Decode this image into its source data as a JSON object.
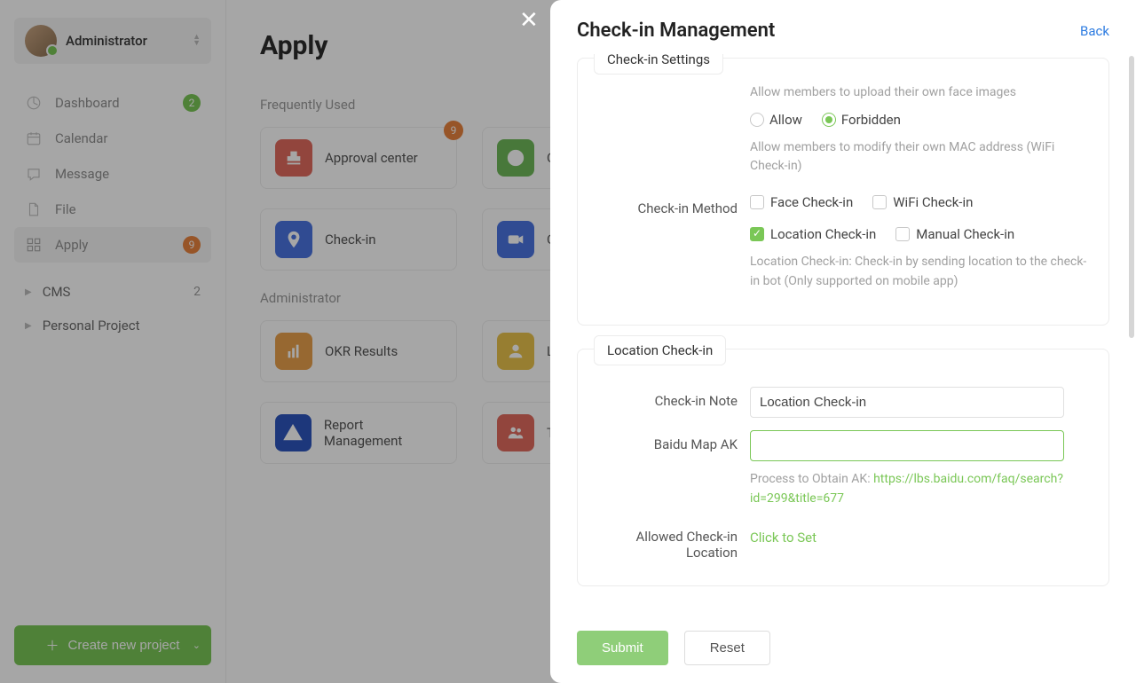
{
  "sidebar": {
    "user": "Administrator",
    "nav": [
      {
        "label": "Dashboard",
        "badge": "2",
        "badgeColor": "green"
      },
      {
        "label": "Calendar"
      },
      {
        "label": "Message"
      },
      {
        "label": "File"
      },
      {
        "label": "Apply",
        "badge": "9",
        "badgeColor": "orange",
        "active": true
      }
    ],
    "sections": [
      {
        "label": "CMS",
        "count": "2"
      },
      {
        "label": "Personal Project"
      }
    ],
    "newProject": "Create new project"
  },
  "main": {
    "title": "Apply",
    "freqHeading": "Frequently Used",
    "adminHeading": "Administrator",
    "tiles": {
      "approval": {
        "label": "Approval center",
        "badge": "9",
        "color": "#e06a5e"
      },
      "okr": {
        "label": "OKR",
        "color": "#6fb85a"
      },
      "checkin": {
        "label": "Check-in",
        "color": "#4a74e0"
      },
      "online": {
        "label": "Online Meeting",
        "color": "#4a74e0"
      },
      "okrres": {
        "label": "OKR Results",
        "color": "#e9a04c"
      },
      "lda": {
        "label": "LDAP",
        "color": "#e9c24c"
      },
      "report": {
        "label": "Report Management",
        "color": "#2d55bd"
      },
      "team": {
        "label": "Team",
        "color": "#e06a5e"
      }
    }
  },
  "drawer": {
    "title": "Check-in Management",
    "back": "Back",
    "panel1": {
      "title": "Check-in Settings",
      "faceHint": "Allow members to upload their own face images",
      "allow": "Allow",
      "forbidden": "Forbidden",
      "macHint": "Allow members to modify their own MAC address (WiFi Check-in)",
      "methodLabel": "Check-in Method",
      "faceCheck": "Face Check-in",
      "wifiCheck": "WiFi Check-in",
      "locCheck": "Location Check-in",
      "manCheck": "Manual Check-in",
      "locHint": "Location Check-in: Check-in by sending location to the check-in bot (Only supported on mobile app)"
    },
    "panel2": {
      "title": "Location Check-in",
      "noteLabel": "Check-in Note",
      "noteValue": "Location Check-in",
      "akLabel": "Baidu Map AK",
      "akValue": "",
      "akHintPrefix": "Process to Obtain AK: ",
      "akLink": "https://lbs.baidu.com/faq/search?id=299&title=677",
      "allowedLabel": "Allowed Check-in Location",
      "clickSet": "Click to Set"
    },
    "submit": "Submit",
    "reset": "Reset"
  }
}
